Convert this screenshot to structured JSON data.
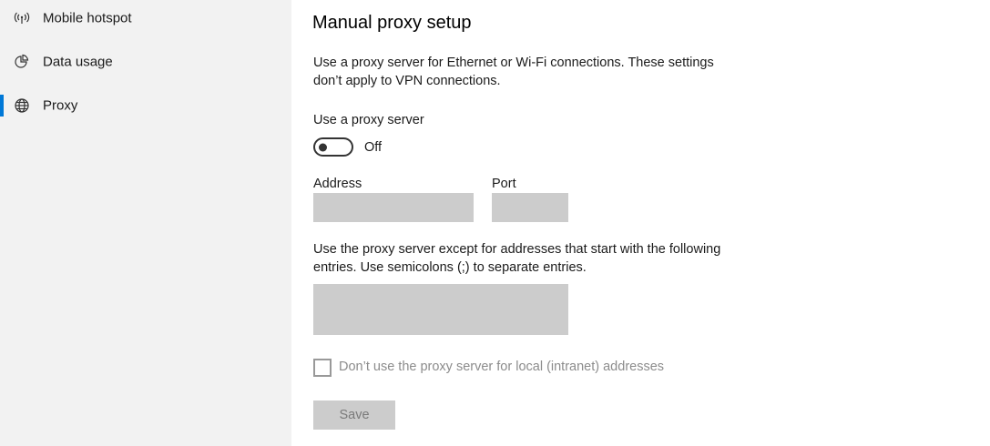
{
  "sidebar": {
    "items": [
      {
        "label": "Mobile hotspot",
        "icon": "mobile-hotspot-icon",
        "selected": false
      },
      {
        "label": "Data usage",
        "icon": "data-usage-icon",
        "selected": false
      },
      {
        "label": "Proxy",
        "icon": "globe-icon",
        "selected": true
      }
    ],
    "accent_color": "#0078d7"
  },
  "main": {
    "heading": "Manual proxy setup",
    "description": "Use a proxy server for Ethernet or Wi-Fi connections. These settings don’t apply to VPN connections.",
    "use_proxy": {
      "label": "Use a proxy server",
      "state_text": "Off",
      "on": false
    },
    "address": {
      "label": "Address",
      "value": ""
    },
    "port": {
      "label": "Port",
      "value": ""
    },
    "exceptions": {
      "description": "Use the proxy server except for addresses that start with the following entries. Use semicolons (;) to separate entries.",
      "value": ""
    },
    "local_bypass": {
      "label": "Don’t use the proxy server for local (intranet) addresses",
      "checked": false
    },
    "save_label": "Save"
  }
}
